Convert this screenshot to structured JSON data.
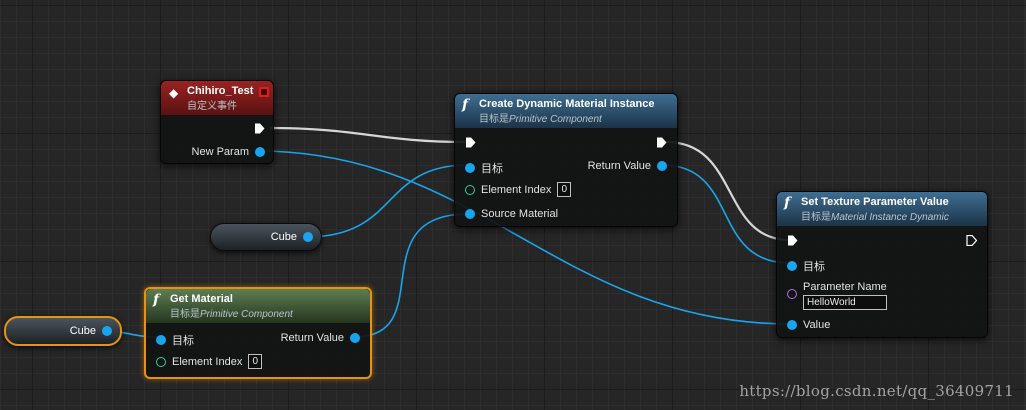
{
  "nodes": {
    "custom_event": {
      "title": "Chihiro_Test",
      "subtitle": "自定义事件",
      "output_param": "New Param",
      "header_color": "#8b1e1e"
    },
    "create_dmi": {
      "title": "Create Dynamic Material Instance",
      "subtitle_prefix": "目标是",
      "subtitle_class": "Primitive Component",
      "target_label": "目标",
      "element_index_label": "Element Index",
      "element_index_value": "0",
      "source_material_label": "Source Material",
      "return_value_label": "Return Value",
      "header_color": "#35607f"
    },
    "set_texture_param": {
      "title": "Set Texture Parameter Value",
      "subtitle_prefix": "目标是",
      "subtitle_class": "Material Instance Dynamic",
      "target_label": "目标",
      "parameter_name_label": "Parameter Name",
      "parameter_name_value": "HelloWorld",
      "value_label": "Value",
      "header_color": "#35607f"
    },
    "get_material": {
      "title": "Get Material",
      "subtitle_prefix": "目标是",
      "subtitle_class": "Primitive Component",
      "target_label": "目标",
      "element_index_label": "Element Index",
      "element_index_value": "0",
      "return_value_label": "Return Value",
      "header_color": "#4f6b45"
    },
    "cube_var_1": {
      "label": "Cube"
    },
    "cube_var_2": {
      "label": "Cube"
    }
  },
  "pin_colors": {
    "object": "#19a5ee",
    "integer": "#2ecf96",
    "name": "#a676e8",
    "exec": "#ffffff"
  },
  "watermark": "https://blog.csdn.net/qq_36409711"
}
